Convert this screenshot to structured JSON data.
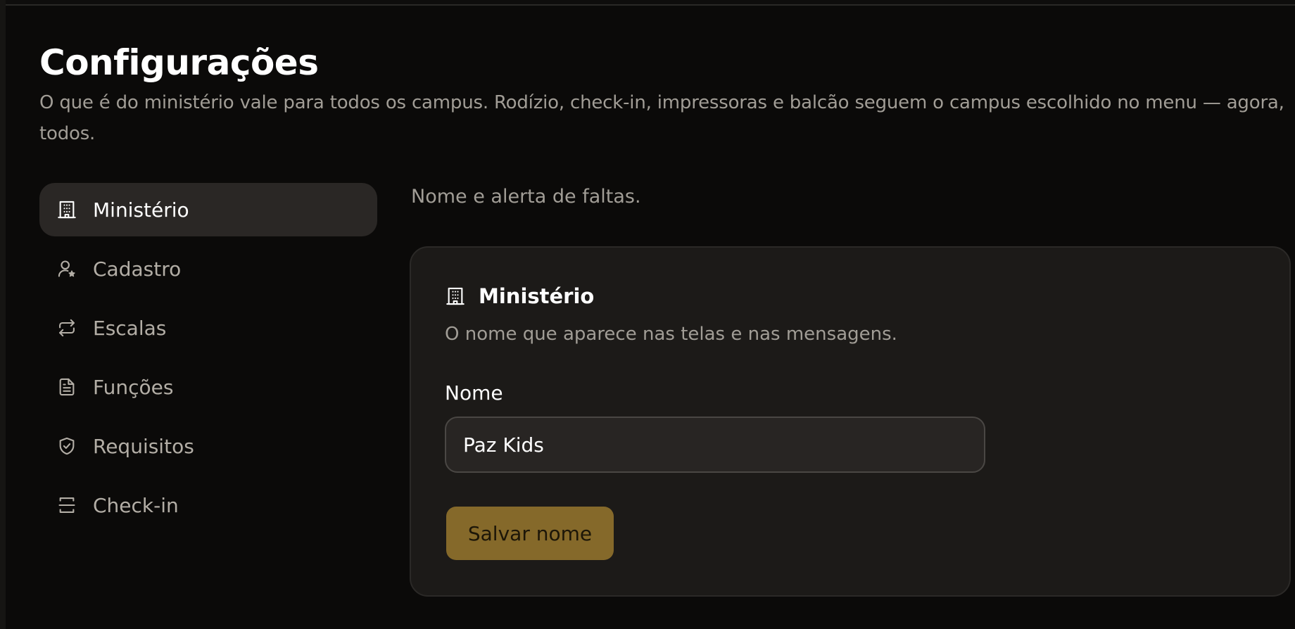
{
  "page": {
    "title": "Configurações",
    "subtitle": "O que é do ministério vale para todos os campus. Rodízio, check-in, impressoras e balcão seguem o campus escolhido no menu — agora, todos."
  },
  "sidebar": {
    "items": [
      {
        "label": "Ministério",
        "icon": "building-icon",
        "active": true
      },
      {
        "label": "Cadastro",
        "icon": "user-star-icon",
        "active": false
      },
      {
        "label": "Escalas",
        "icon": "repeat-icon",
        "active": false
      },
      {
        "label": "Funções",
        "icon": "document-icon",
        "active": false
      },
      {
        "label": "Requisitos",
        "icon": "shield-check-icon",
        "active": false
      },
      {
        "label": "Check-in",
        "icon": "scan-icon",
        "active": false
      }
    ]
  },
  "main": {
    "caption": "Nome e alerta de faltas.",
    "card": {
      "icon": "building-icon",
      "title": "Ministério",
      "description": "O nome que aparece nas telas e nas mensagens.",
      "field_label": "Nome",
      "input_value": "Paz Kids",
      "save_label": "Salvar nome"
    }
  },
  "colors": {
    "background": "#0b0a09",
    "card": "#1c1a18",
    "active_nav": "#2a2725",
    "accent_button": "#85692a",
    "muted_text": "#a19d96"
  }
}
